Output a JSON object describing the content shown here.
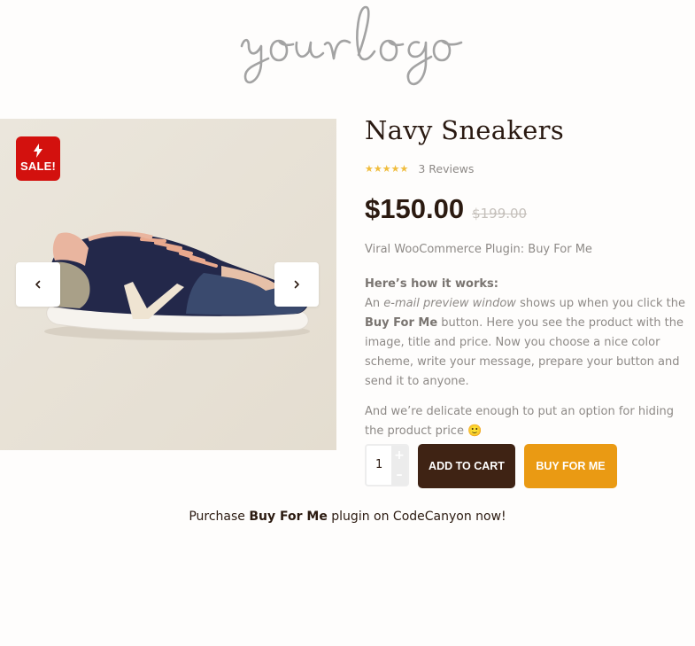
{
  "logo": {
    "text": "your logo"
  },
  "gallery": {
    "badge": {
      "label": "SALE!",
      "icon": "lightning-bolt-icon",
      "color": "#d3110e"
    },
    "prev_icon": "chevron-left-icon",
    "next_icon": "chevron-right-icon"
  },
  "product": {
    "title": "Navy Sneakers",
    "rating": {
      "stars": 5,
      "max": 5,
      "reviews_label": "3 Reviews"
    },
    "price": {
      "current": "$150.00",
      "old": "$199.00"
    },
    "subtitle": "Viral WooCommerce Plugin: Buy For Me",
    "desc": {
      "heading": "Here’s how it works:",
      "p1_a": "An ",
      "p1_em": "e-mail preview window",
      "p1_b": " shows up when you click the ",
      "p1_strong": "Buy For Me",
      "p1_c": " button. Here you see the product with the image, title and price. Now you choose a nice color scheme, write your message, prepare your button and send it to anyone.",
      "p2": "And we’re delicate enough to put an option for hiding the product price ",
      "p2_emoji": "🙂"
    },
    "quantity": "1",
    "qty_plus": "+",
    "qty_minus": "–",
    "add_to_cart_label": "ADD TO CART",
    "buy_for_me_label": "BUY FOR ME"
  },
  "promo": {
    "a": "Purchase ",
    "b": "Buy For Me",
    "c": " plugin on CodeCanyon now!"
  },
  "colors": {
    "accent": "#ea9a13",
    "dark_brown": "#3f2314",
    "sale_red": "#d3110e",
    "star_gold": "#f0bd3d"
  }
}
